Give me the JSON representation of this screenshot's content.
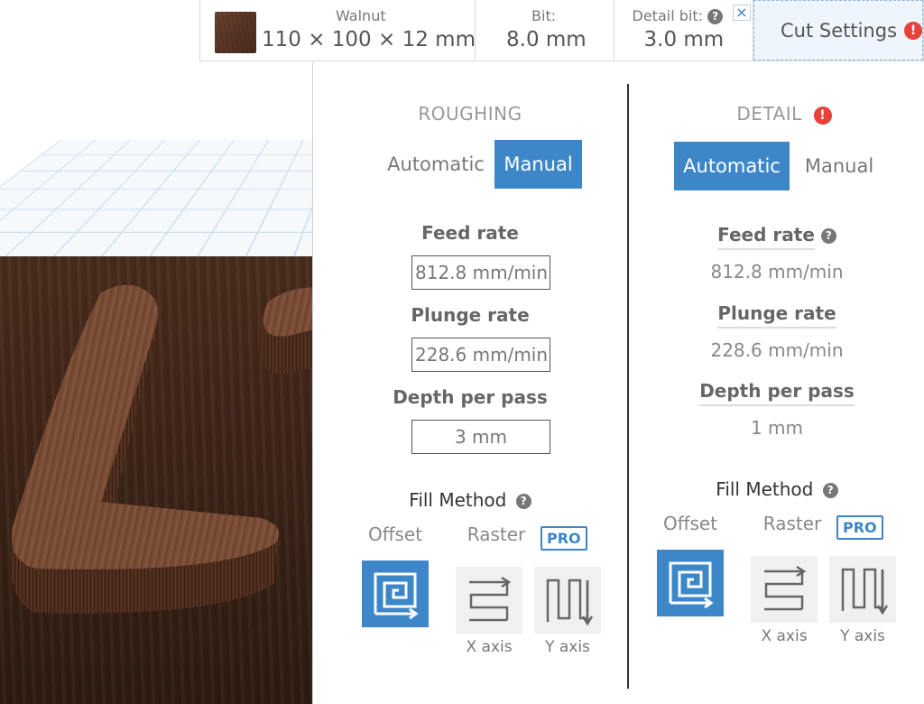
{
  "material_bar": {
    "material_label": "Walnut",
    "material_size": "110 × 100 × 12 mm",
    "bit_label": "Bit:",
    "bit_value": "8.0 mm",
    "detail_bit_label": "Detail bit:",
    "detail_bit_value": "3.0 mm",
    "close_glyph": "×",
    "cut_settings_label": "Cut Settings",
    "warning_glyph": "!",
    "help_glyph": "?"
  },
  "roughing": {
    "title": "ROUGHING",
    "mode_options": [
      "Automatic",
      "Manual"
    ],
    "active_mode": "Manual",
    "feed_rate_label": "Feed rate",
    "feed_rate_value": "812.8 mm/min",
    "plunge_rate_label": "Plunge rate",
    "plunge_rate_value": "228.6 mm/min",
    "depth_label": "Depth per pass",
    "depth_value": "3 mm",
    "fill_method_label": "Fill Method",
    "fill_offset_label": "Offset",
    "fill_raster_label": "Raster",
    "pro_badge": "PRO",
    "x_axis_label": "X axis",
    "y_axis_label": "Y axis",
    "active_fill": "Offset"
  },
  "detail": {
    "title": "DETAIL",
    "mode_options": [
      "Automatic",
      "Manual"
    ],
    "active_mode": "Automatic",
    "feed_rate_label": "Feed rate",
    "feed_rate_value": "812.8 mm/min",
    "plunge_rate_label": "Plunge rate",
    "plunge_rate_value": "228.6 mm/min",
    "depth_label": "Depth per pass",
    "depth_value": "1 mm",
    "fill_method_label": "Fill Method",
    "fill_offset_label": "Offset",
    "fill_raster_label": "Raster",
    "pro_badge": "PRO",
    "x_axis_label": "X axis",
    "y_axis_label": "Y axis",
    "active_fill": "Offset"
  },
  "colors": {
    "accent": "#3d87c9",
    "warning": "#e8413a",
    "wood": "#6b4230"
  },
  "icons": {
    "offset": "offset-spiral-icon",
    "raster_x": "raster-x-axis-icon",
    "raster_y": "raster-y-axis-icon",
    "warning": "warning-icon",
    "help": "help-icon",
    "close": "close-icon"
  }
}
